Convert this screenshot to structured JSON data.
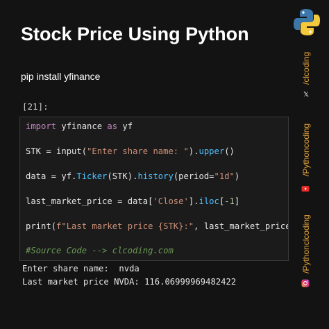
{
  "header": {
    "title": "Stock Price Using Python"
  },
  "install_text": "pip install yfinance",
  "cell_label": "[21]:",
  "code": {
    "l1_kw": "import",
    "l1_a": " yfinance ",
    "l1_as": "as",
    "l1_b": " yf",
    "l2_a": "STK = input(",
    "l2_str": "\"Enter share name: \"",
    "l2_b": ").",
    "l2_fn": "upper",
    "l2_c": "()",
    "l3_a": "data = yf.",
    "l3_fn1": "Ticker",
    "l3_b": "(STK).",
    "l3_fn2": "history",
    "l3_c": "(period=",
    "l3_str": "\"1d\"",
    "l3_d": ")",
    "l4_a": "last_market_price = data[",
    "l4_str": "'Close'",
    "l4_b": "].",
    "l4_fn": "iloc",
    "l4_c": "[",
    "l4_num": "-1",
    "l4_d": "]",
    "l5_a": "print(",
    "l5_str": "f\"Last market price {STK}:\"",
    "l5_b": ", last_market_price)",
    "l6_cm": "#Source Code --> clcoding.com"
  },
  "output": {
    "line1": "Enter share name:  nvda",
    "line2": "Last market price NVDA: 116.06999969482422"
  },
  "rail": {
    "handle_x": "/clcoding",
    "handle_youtube": "/Pythoncoding",
    "handle_instagram": "/Pythonclcoding",
    "x_icon_glyph": "𝕏"
  },
  "colors": {
    "background": "#131313",
    "accent": "#e0a13a",
    "keyword": "#c586c0",
    "function": "#4fc1ff",
    "string": "#ce9178",
    "comment": "#6a9955"
  },
  "icons": [
    "python-logo-icon",
    "x-icon",
    "youtube-icon",
    "instagram-icon"
  ]
}
